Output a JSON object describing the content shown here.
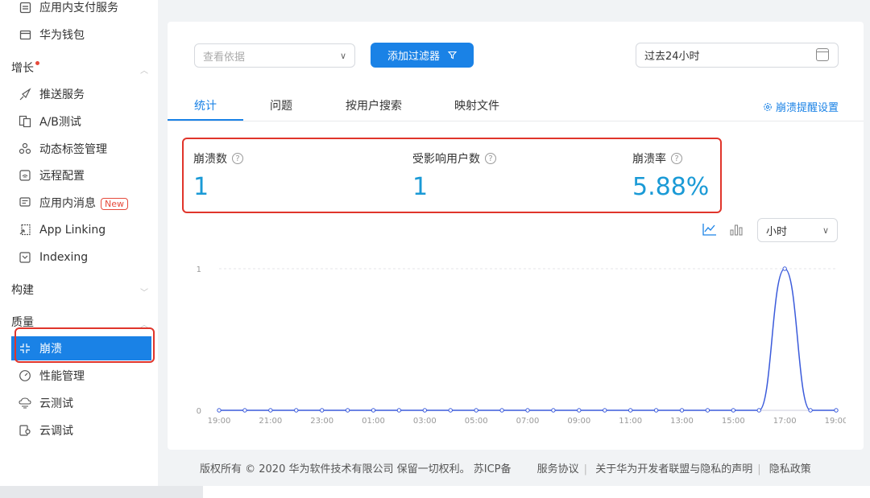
{
  "sidebar": {
    "items_top": [
      {
        "label": "应用内支付服务",
        "icon": "payment-icon"
      },
      {
        "label": "华为钱包",
        "icon": "wallet-icon"
      }
    ],
    "groups": {
      "growth": "增长",
      "build": "构建",
      "quality": "质量"
    },
    "growth_items": [
      {
        "label": "推送服务",
        "icon": "push-icon"
      },
      {
        "label": "A/B测试",
        "icon": "ab-test-icon"
      },
      {
        "label": "动态标签管理",
        "icon": "tag-icon"
      },
      {
        "label": "远程配置",
        "icon": "remote-config-icon"
      },
      {
        "label": "应用内消息",
        "icon": "message-icon",
        "badge": "New"
      },
      {
        "label": "App Linking",
        "icon": "link-icon"
      },
      {
        "label": "Indexing",
        "icon": "indexing-icon"
      }
    ],
    "quality_items": [
      {
        "label": "崩溃",
        "icon": "crash-icon",
        "active": true
      },
      {
        "label": "性能管理",
        "icon": "performance-icon"
      },
      {
        "label": "云测试",
        "icon": "cloud-test-icon"
      },
      {
        "label": "云调试",
        "icon": "cloud-debug-icon"
      }
    ]
  },
  "toolbar": {
    "view_basis_placeholder": "查看依据",
    "add_filter_label": "添加过滤器",
    "date_range": "过去24小时"
  },
  "tabs": [
    {
      "label": "统计",
      "active": true
    },
    {
      "label": "问题"
    },
    {
      "label": "按用户搜索"
    },
    {
      "label": "映射文件"
    }
  ],
  "alert_settings_label": "崩溃提醒设置",
  "metrics": [
    {
      "name": "崩溃数",
      "value": "1"
    },
    {
      "name": "受影响用户数",
      "value": "1"
    },
    {
      "name": "崩溃率",
      "value": "5.88%"
    }
  ],
  "unit_select": "小时",
  "chart_data": {
    "type": "line",
    "x": [
      "19:00",
      "20:00",
      "21:00",
      "22:00",
      "23:00",
      "00:00",
      "01:00",
      "02:00",
      "03:00",
      "04:00",
      "05:00",
      "06:00",
      "07:00",
      "08:00",
      "09:00",
      "10:00",
      "11:00",
      "12:00",
      "13:00",
      "14:00",
      "15:00",
      "16:00",
      "17:00",
      "18:00",
      "19:00"
    ],
    "x_tick_labels": [
      "19:00",
      "21:00",
      "23:00",
      "01:00",
      "03:00",
      "05:00",
      "07:00",
      "09:00",
      "11:00",
      "13:00",
      "15:00",
      "17:00",
      "19:00"
    ],
    "series": [
      {
        "values": [
          0,
          0,
          0,
          0,
          0,
          0,
          0,
          0,
          0,
          0,
          0,
          0,
          0,
          0,
          0,
          0,
          0,
          0,
          0,
          0,
          0,
          0,
          1,
          0,
          0
        ]
      }
    ],
    "y_ticks": [
      "0",
      "1"
    ],
    "ylim": [
      0,
      1
    ],
    "grid": true,
    "color": "#3b5bdb"
  },
  "footer": {
    "copyright": "版权所有 © 2020 华为软件技术有限公司 保留一切权利。 苏ICP备",
    "links": [
      "服务协议",
      "关于华为开发者联盟与隐私的声明",
      "隐私政策"
    ]
  }
}
